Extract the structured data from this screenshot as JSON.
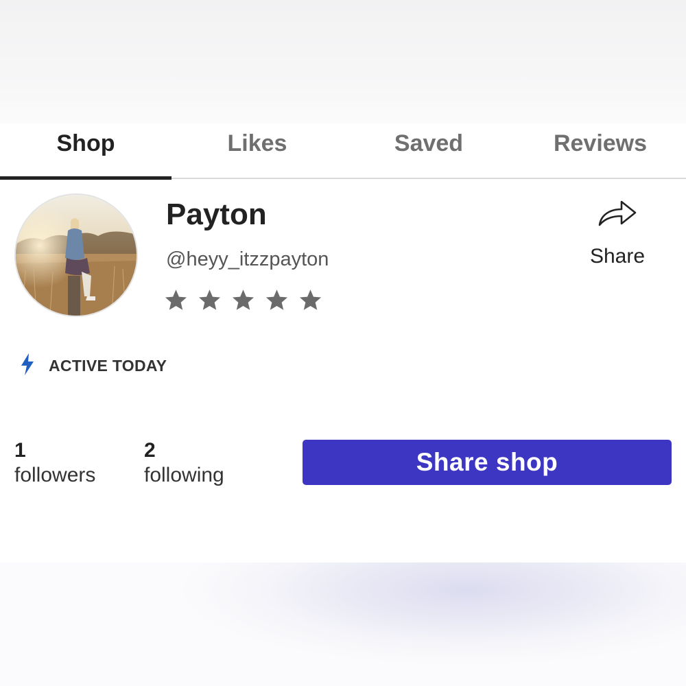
{
  "tabs": [
    {
      "label": "Shop",
      "active": true
    },
    {
      "label": "Likes",
      "active": false
    },
    {
      "label": "Saved",
      "active": false
    },
    {
      "label": "Reviews",
      "active": false
    }
  ],
  "profile": {
    "name": "Payton",
    "handle": "@heyy_itzzpayton",
    "rating_stars": 5,
    "avatar_icon": "profile-photo"
  },
  "share": {
    "icon": "share-arrow-icon",
    "label": "Share"
  },
  "activity": {
    "icon": "lightning-bolt-icon",
    "label": "ACTIVE TODAY",
    "icon_color": "#1f5fbf"
  },
  "stats": {
    "followers": {
      "count": "1",
      "label": "followers"
    },
    "following": {
      "count": "2",
      "label": "following"
    }
  },
  "actions": {
    "share_shop_label": "Share shop",
    "share_shop_color": "#3d36c2"
  }
}
